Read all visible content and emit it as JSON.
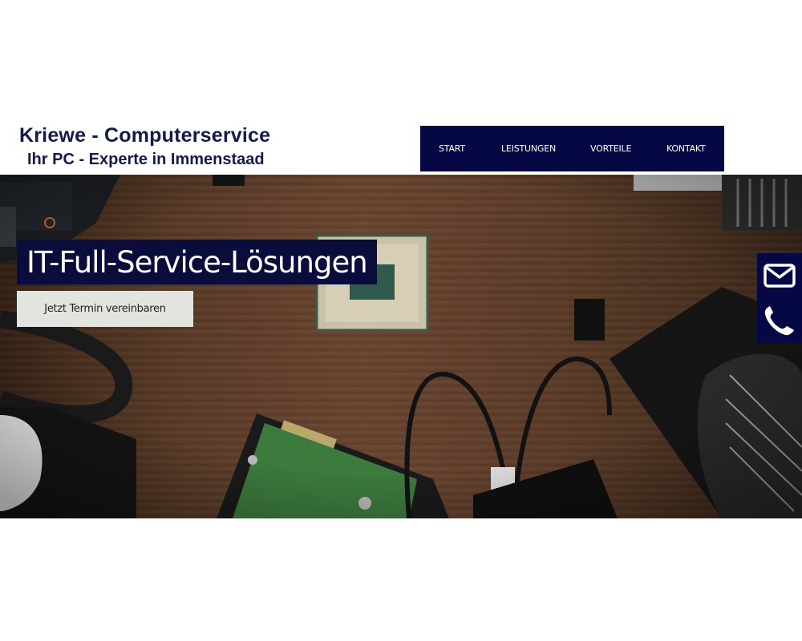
{
  "header": {
    "title": "Kriewe - Computerservice",
    "subtitle": "Ihr PC - Experte in Immenstaad"
  },
  "nav": {
    "items": [
      {
        "label": "START"
      },
      {
        "label": "LEISTUNGEN"
      },
      {
        "label": "VORTEILE"
      },
      {
        "label": "KONTAKT"
      }
    ]
  },
  "hero": {
    "title": "IT-Full-Service-Lösungen",
    "cta_label": "Jetzt Termin vereinbaren",
    "image": "computer-hardware-on-wooden-desk"
  },
  "side_contact": {
    "icons": [
      "envelope-icon",
      "phone-icon"
    ]
  },
  "colors": {
    "brand_navy": "#060845",
    "title_text": "#141a4a",
    "cta_bg": "#e2e4e0"
  }
}
